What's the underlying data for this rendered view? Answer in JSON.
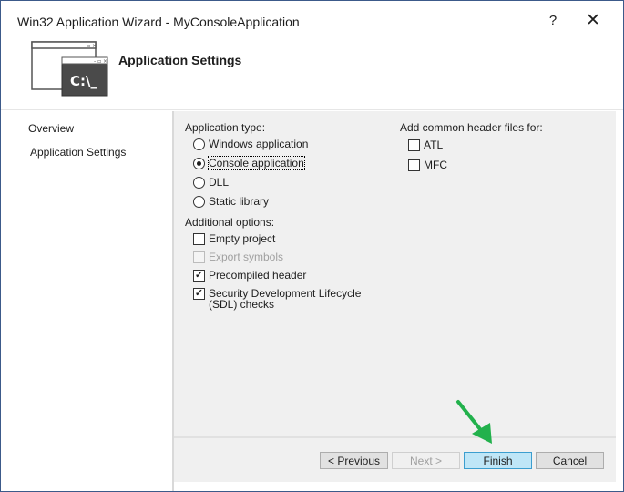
{
  "window": {
    "title": "Win32 Application Wizard - MyConsoleApplication",
    "help_label": "?",
    "close_label": "✕"
  },
  "header": {
    "title": "Application Settings",
    "icon_text": "C:\\_"
  },
  "nav": {
    "items": [
      {
        "label": "Overview"
      },
      {
        "label": "Application Settings"
      }
    ]
  },
  "settings": {
    "app_type_label": "Application type:",
    "app_types": [
      {
        "label": "Windows application",
        "selected": false
      },
      {
        "label": "Console application",
        "selected": true
      },
      {
        "label": "DLL",
        "selected": false
      },
      {
        "label": "Static library",
        "selected": false
      }
    ],
    "additional_label": "Additional options:",
    "additional": [
      {
        "label": "Empty project",
        "checked": false,
        "enabled": true
      },
      {
        "label": "Export symbols",
        "checked": false,
        "enabled": false
      },
      {
        "label": "Precompiled header",
        "checked": true,
        "enabled": true
      },
      {
        "label": "Security Development Lifecycle (SDL) checks",
        "checked": true,
        "enabled": true
      }
    ],
    "headers_label": "Add common header files for:",
    "headers": [
      {
        "label": "ATL",
        "checked": false
      },
      {
        "label": "MFC",
        "checked": false
      }
    ]
  },
  "buttons": {
    "previous": "< Previous",
    "next": "Next >",
    "finish": "Finish",
    "cancel": "Cancel"
  },
  "colors": {
    "accent_arrow": "#22b14c",
    "finish_highlight": "#bfe6f7"
  }
}
